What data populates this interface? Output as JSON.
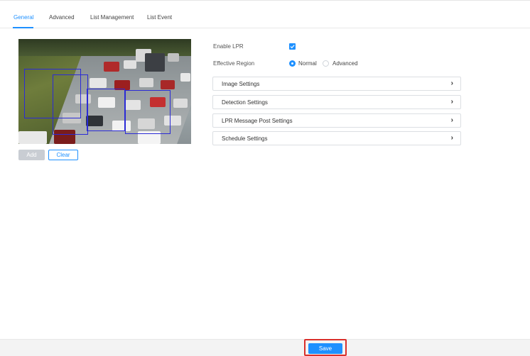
{
  "tabs": [
    {
      "label": "General",
      "active": true
    },
    {
      "label": "Advanced",
      "active": false
    },
    {
      "label": "List Management",
      "active": false
    },
    {
      "label": "List Event",
      "active": false
    }
  ],
  "region_buttons": {
    "add_label": "Add",
    "clear_label": "Clear"
  },
  "settings": {
    "enable_lpr_label": "Enable LPR",
    "enable_lpr_checked": true,
    "effective_region_label": "Effective Region",
    "region_options": [
      "Normal",
      "Advanced"
    ],
    "region_selected": "Normal"
  },
  "panels": [
    {
      "label": "Image Settings"
    },
    {
      "label": "Detection Settings"
    },
    {
      "label": "LPR Message Post Settings"
    },
    {
      "label": "Schedule Settings"
    }
  ],
  "footer": {
    "save_label": "Save"
  },
  "colors": {
    "accent": "#1e90ff",
    "highlight": "#d9302c",
    "zone": "#2b2bd6"
  }
}
